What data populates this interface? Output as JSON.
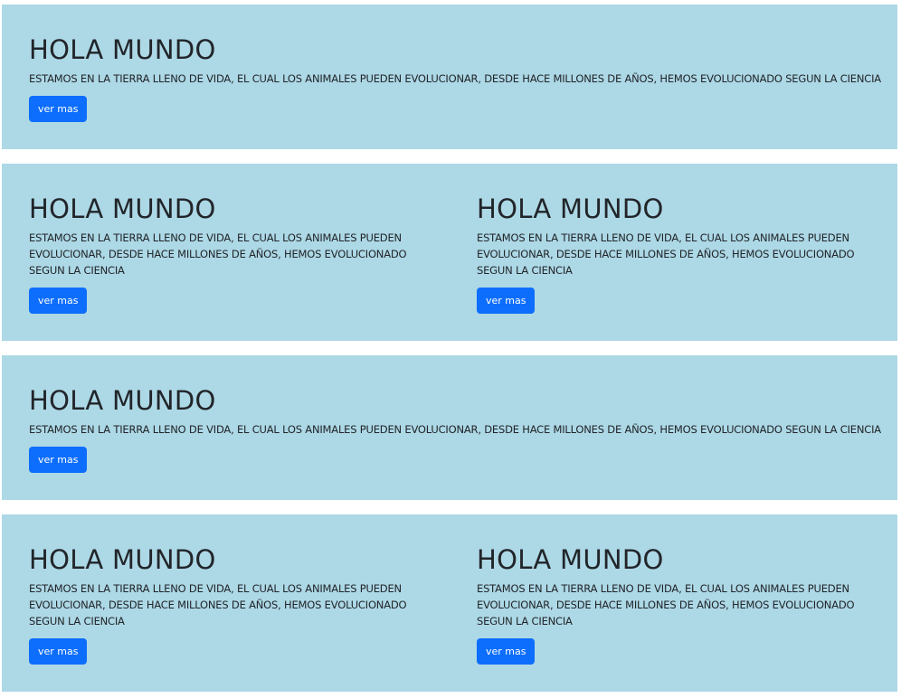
{
  "colors": {
    "section_bg": "#add8e6",
    "button_bg": "#0d6efd",
    "button_text": "#ffffff",
    "heading_text": "#212529"
  },
  "sections": [
    {
      "blocks": [
        {
          "title": "HOLA MUNDO",
          "text": "ESTAMOS EN LA TIERRA LLENO DE VIDA, EL CUAL LOS ANIMALES PUEDEN EVOLUCIONAR, DESDE HACE MILLONES DE AÑOS, HEMOS EVOLUCIONADO SEGUN LA CIENCIA",
          "button": "ver mas"
        }
      ]
    },
    {
      "blocks": [
        {
          "title": "HOLA MUNDO",
          "text": "ESTAMOS EN LA TIERRA LLENO DE VIDA, EL CUAL LOS ANIMALES PUEDEN EVOLUCIONAR, DESDE HACE MILLONES DE AÑOS, HEMOS EVOLUCIONADO SEGUN LA CIENCIA",
          "button": "ver mas"
        },
        {
          "title": "HOLA MUNDO",
          "text": "ESTAMOS EN LA TIERRA LLENO DE VIDA, EL CUAL LOS ANIMALES PUEDEN EVOLUCIONAR, DESDE HACE MILLONES DE AÑOS, HEMOS EVOLUCIONADO SEGUN LA CIENCIA",
          "button": "ver mas"
        }
      ]
    },
    {
      "blocks": [
        {
          "title": "HOLA MUNDO",
          "text": "ESTAMOS EN LA TIERRA LLENO DE VIDA, EL CUAL LOS ANIMALES PUEDEN EVOLUCIONAR, DESDE HACE MILLONES DE AÑOS, HEMOS EVOLUCIONADO SEGUN LA CIENCIA",
          "button": "ver mas"
        }
      ]
    },
    {
      "blocks": [
        {
          "title": "HOLA MUNDO",
          "text": "ESTAMOS EN LA TIERRA LLENO DE VIDA, EL CUAL LOS ANIMALES PUEDEN EVOLUCIONAR, DESDE HACE MILLONES DE AÑOS, HEMOS EVOLUCIONADO SEGUN LA CIENCIA",
          "button": "ver mas"
        },
        {
          "title": "HOLA MUNDO",
          "text": "ESTAMOS EN LA TIERRA LLENO DE VIDA, EL CUAL LOS ANIMALES PUEDEN EVOLUCIONAR, DESDE HACE MILLONES DE AÑOS, HEMOS EVOLUCIONADO SEGUN LA CIENCIA",
          "button": "ver mas"
        }
      ]
    }
  ]
}
